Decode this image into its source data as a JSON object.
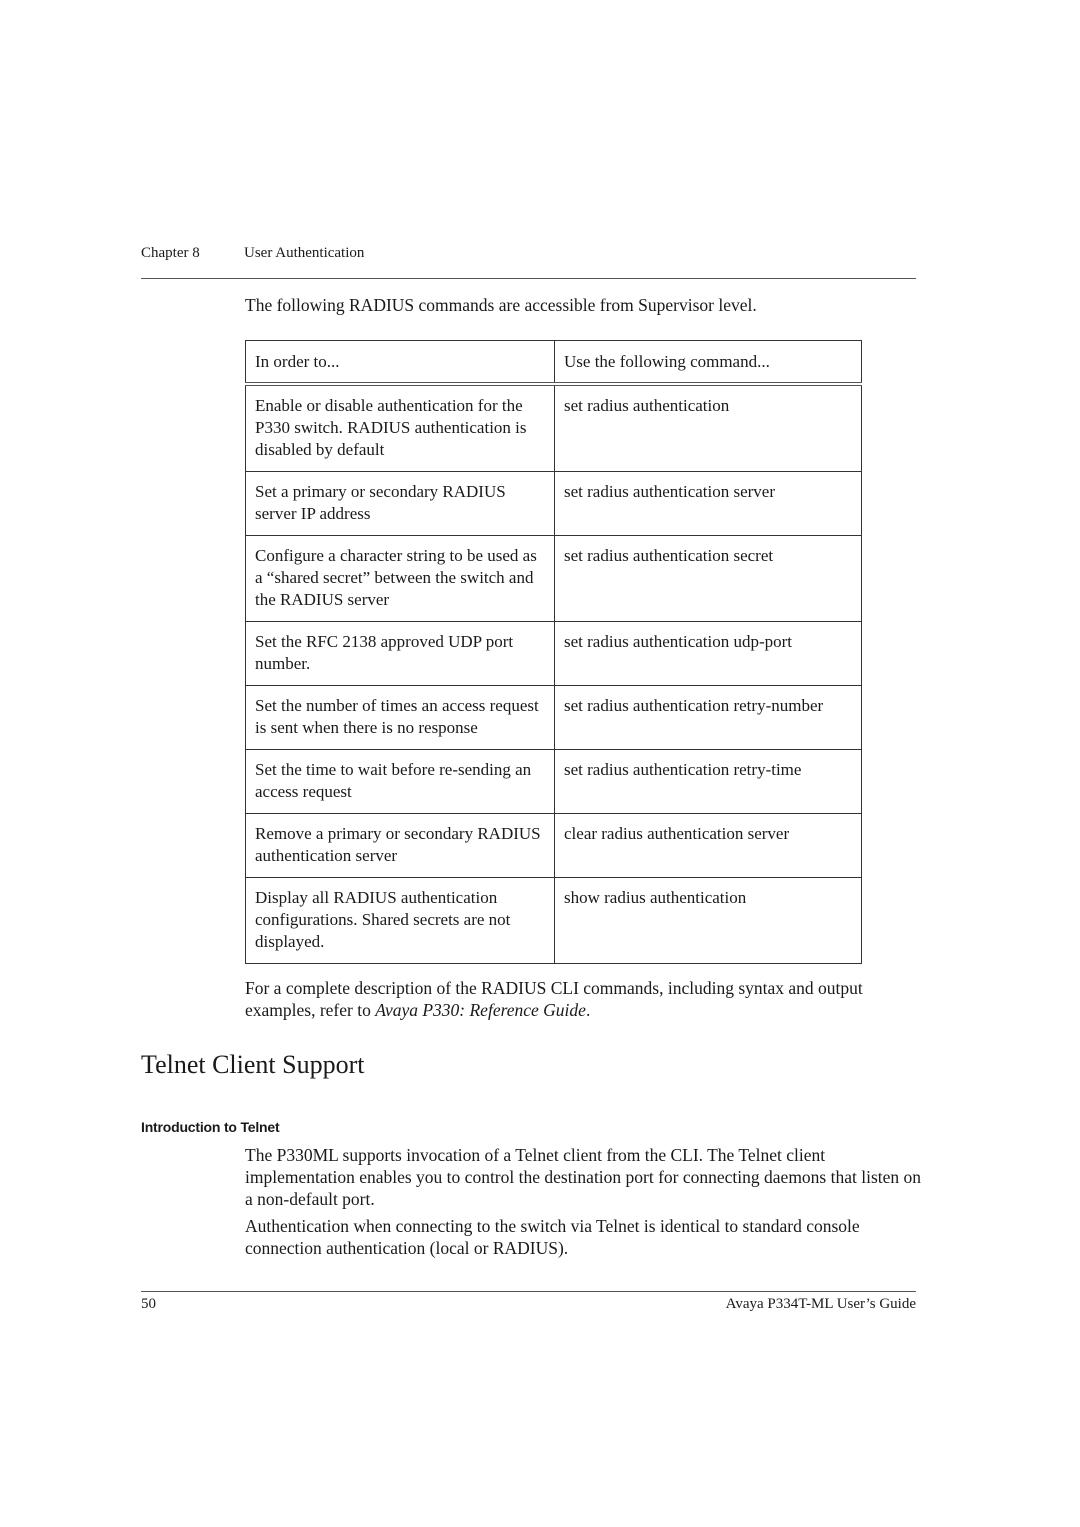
{
  "header": {
    "chapter": "Chapter 8",
    "section": "User Authentication"
  },
  "intro": "The following RADIUS commands are accessible from Supervisor level.",
  "table": {
    "columns": [
      "In order to...",
      "Use the following command..."
    ],
    "rows": [
      {
        "purpose": "Enable or disable authentication for the P330 switch. RADIUS authentication is disabled by default",
        "command": "set radius authentication"
      },
      {
        "purpose": "Set a primary or secondary RADIUS server IP address",
        "command": "set radius authentication server"
      },
      {
        "purpose": "Configure a character string to be used as a “shared secret” between the switch and the RADIUS server",
        "command": "set radius authentication secret"
      },
      {
        "purpose": "Set the RFC 2138 approved UDP port number.",
        "command": "set radius authentication udp-port"
      },
      {
        "purpose": "Set the number of times an access request is sent when there is no response",
        "command": "set radius authentication retry-number"
      },
      {
        "purpose": "Set the time to wait before re-sending an access request",
        "command": "set radius authentication retry-time"
      },
      {
        "purpose": "Remove a primary or secondary RADIUS authentication server",
        "command": "clear radius authentication server"
      },
      {
        "purpose": "Display all RADIUS authentication configurations. Shared secrets are not displayed.",
        "command": "show radius authentication"
      }
    ]
  },
  "reference_para": {
    "before": "For a complete description of the RADIUS CLI commands, including syntax and output examples, refer to ",
    "italic": "Avaya P330: Reference Guide",
    "after": "."
  },
  "section_title": "Telnet Client Support",
  "subsection_title": "Introduction to Telnet",
  "body_paragraphs": [
    "The P330ML supports invocation of a Telnet client from the CLI. The Telnet client implementation enables you to control the destination port for connecting daemons that listen on a non-default port.",
    "Authentication when connecting to the switch via Telnet is identical to standard console connection authentication (local or RADIUS)."
  ],
  "footer": {
    "page_number": "50",
    "guide_title": "Avaya P334T-ML User’s Guide"
  }
}
